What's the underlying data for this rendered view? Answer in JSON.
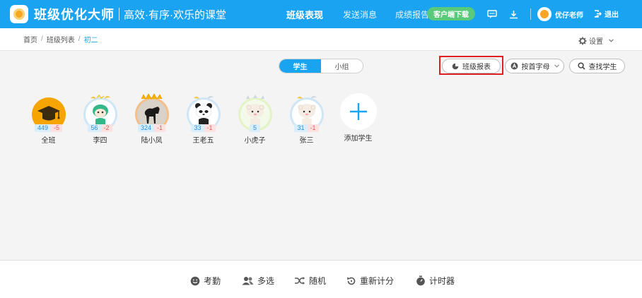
{
  "header": {
    "brand": "班级优化大师",
    "slogan": "高效·有序·欢乐的课堂",
    "nav": [
      {
        "label": "班级表现",
        "active": true
      },
      {
        "label": "发送消息",
        "active": false
      },
      {
        "label": "成绩报告",
        "active": false
      }
    ],
    "download_label": "客户端下载",
    "user_name": "优仔老师",
    "logout_label": "退出",
    "colors": {
      "bar": "#1aa3f0",
      "download": "#59c97a"
    }
  },
  "breadcrumb": {
    "items": [
      "首页",
      "班级列表",
      "初二"
    ],
    "separator": "/",
    "settings_label": "设置"
  },
  "toolbar": {
    "segments": [
      "学生",
      "小组"
    ],
    "active_segment": "学生",
    "report_label": "班级报表",
    "sort_label": "按首字母",
    "find_label": "查找学生",
    "highlight_color": "#e02020"
  },
  "students": [
    {
      "name": "全班",
      "pos": "449",
      "neg": "-5",
      "avatar": "graduation-cap"
    },
    {
      "name": "李四",
      "pos": "56",
      "neg": "-2",
      "avatar": "green-dino"
    },
    {
      "name": "陆小凤",
      "pos": "324",
      "neg": "-1",
      "avatar": "horse-photo"
    },
    {
      "name": "王老五",
      "pos": "33",
      "neg": "-1",
      "avatar": "panda"
    },
    {
      "name": "小虎子",
      "pos": "5",
      "neg": "",
      "avatar": "sheep-green"
    },
    {
      "name": "张三",
      "pos": "31",
      "neg": "-1",
      "avatar": "sheep-blue"
    }
  ],
  "add_student_label": "添加学生",
  "footer": {
    "buttons": [
      {
        "label": "考勤",
        "icon": "smile-icon"
      },
      {
        "label": "多选",
        "icon": "people-icon"
      },
      {
        "label": "随机",
        "icon": "shuffle-icon"
      },
      {
        "label": "重新计分",
        "icon": "reset-icon"
      },
      {
        "label": "计时器",
        "icon": "timer-icon"
      }
    ]
  }
}
